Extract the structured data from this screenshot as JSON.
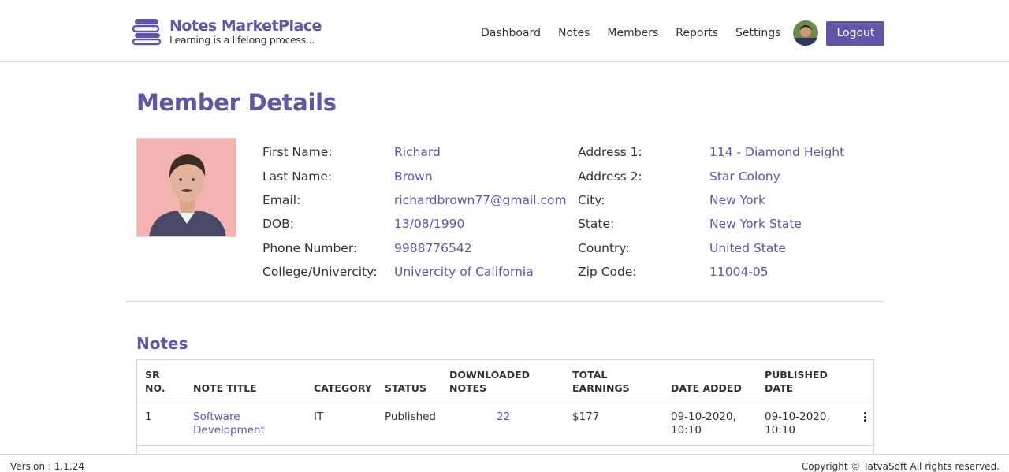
{
  "header": {
    "logo_title": "Notes MarketPlace",
    "logo_subtitle": "Learning is a lifelong process...",
    "nav": [
      "Dashboard",
      "Notes",
      "Members",
      "Reports",
      "Settings"
    ],
    "logout_label": "Logout"
  },
  "page": {
    "title": "Member Details"
  },
  "member": {
    "left": [
      {
        "label": "First Name:",
        "value": "Richard"
      },
      {
        "label": "Last Name:",
        "value": "Brown"
      },
      {
        "label": "Email:",
        "value": "richardbrown77@gmail.com"
      },
      {
        "label": "DOB:",
        "value": "13/08/1990"
      },
      {
        "label": "Phone Number:",
        "value": "9988776542"
      },
      {
        "label": "College/Univercity:",
        "value": "Univercity of California"
      }
    ],
    "right": [
      {
        "label": "Address 1:",
        "value": "114 - Diamond Height"
      },
      {
        "label": "Address 2:",
        "value": "Star Colony"
      },
      {
        "label": "City:",
        "value": "New York"
      },
      {
        "label": "State:",
        "value": "New York State"
      },
      {
        "label": "Country:",
        "value": "United State"
      },
      {
        "label": "Zip Code:",
        "value": "11004-05"
      }
    ]
  },
  "notes": {
    "title": "Notes",
    "headers": {
      "sr_1": "SR",
      "sr_2": "NO.",
      "note_title": "NOTE TITLE",
      "category": "CATEGORY",
      "status": "STATUS",
      "downloaded_1": "DOWNLOADED",
      "downloaded_2": "NOTES",
      "earnings_1": "TOTAL",
      "earnings_2": "EARNINGS",
      "date_added": "DATE ADDED",
      "published_1": "PUBLISHED",
      "published_2": "DATE"
    },
    "rows": [
      {
        "sr": "1",
        "title_1": "Software",
        "title_2": "Development",
        "category": "IT",
        "status": "Published",
        "downloads": "22",
        "earnings": "$177",
        "date_added_1": "09-10-2020,",
        "date_added_2": "10:10",
        "published_1": "09-10-2020,",
        "published_2": "10:10"
      }
    ]
  },
  "footer": {
    "version": "Version : 1.1.24",
    "copyright": "Copyright © TatvaSoft All rights reserved."
  },
  "colors": {
    "accent": "#6255a5",
    "border": "#d5d5d5"
  }
}
